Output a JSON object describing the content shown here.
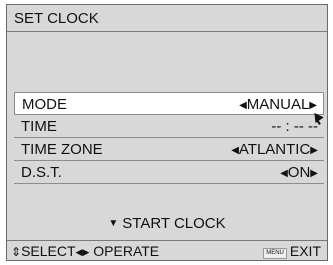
{
  "title": "SET CLOCK",
  "menu": [
    {
      "label": "MODE",
      "value": "MANUAL",
      "selected": true,
      "arrows": true
    },
    {
      "label": "TIME",
      "value": "-- : -- --",
      "selected": false,
      "arrows": false
    },
    {
      "label": "TIME ZONE",
      "value": "ATLANTIC",
      "selected": false,
      "arrows": true
    },
    {
      "label": "D.S.T.",
      "value": "ON",
      "selected": false,
      "arrows": true
    }
  ],
  "start_clock": "START CLOCK",
  "footer": {
    "select_label": "SELECT",
    "operate_label": "OPERATE",
    "menu_button": "MENU",
    "exit_label": "EXIT"
  }
}
